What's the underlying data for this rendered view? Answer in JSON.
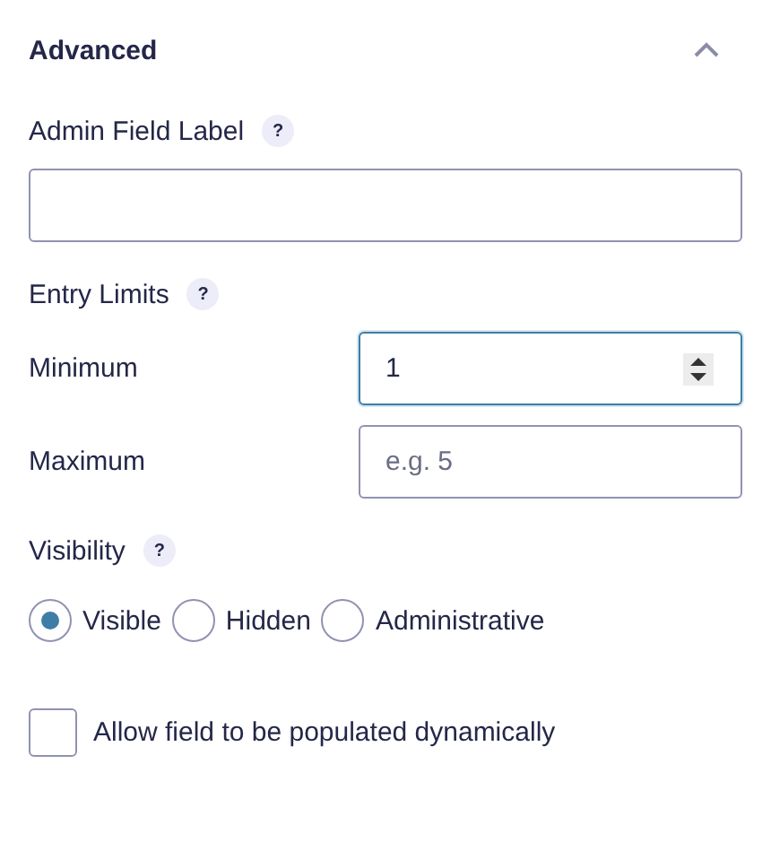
{
  "section": {
    "title": "Advanced",
    "expanded": true
  },
  "admin_label": {
    "label": "Admin Field Label",
    "help": "?"
  },
  "entry_limits": {
    "label": "Entry Limits",
    "help": "?",
    "fields": [
      {
        "label": "Minimum",
        "value": "1",
        "focused": true,
        "spinner": true
      },
      {
        "label": "Maximum",
        "placeholder": "e.g. 5",
        "focused": false,
        "spinner": false
      }
    ]
  },
  "visibility": {
    "label": "Visibility",
    "help": "?",
    "options": [
      {
        "label": "Visible",
        "selected": true
      },
      {
        "label": "Hidden",
        "selected": false
      },
      {
        "label": "Administrative",
        "selected": false
      }
    ]
  },
  "dynamic": {
    "label": "Allow field to be populated dynamically",
    "checked": false
  }
}
